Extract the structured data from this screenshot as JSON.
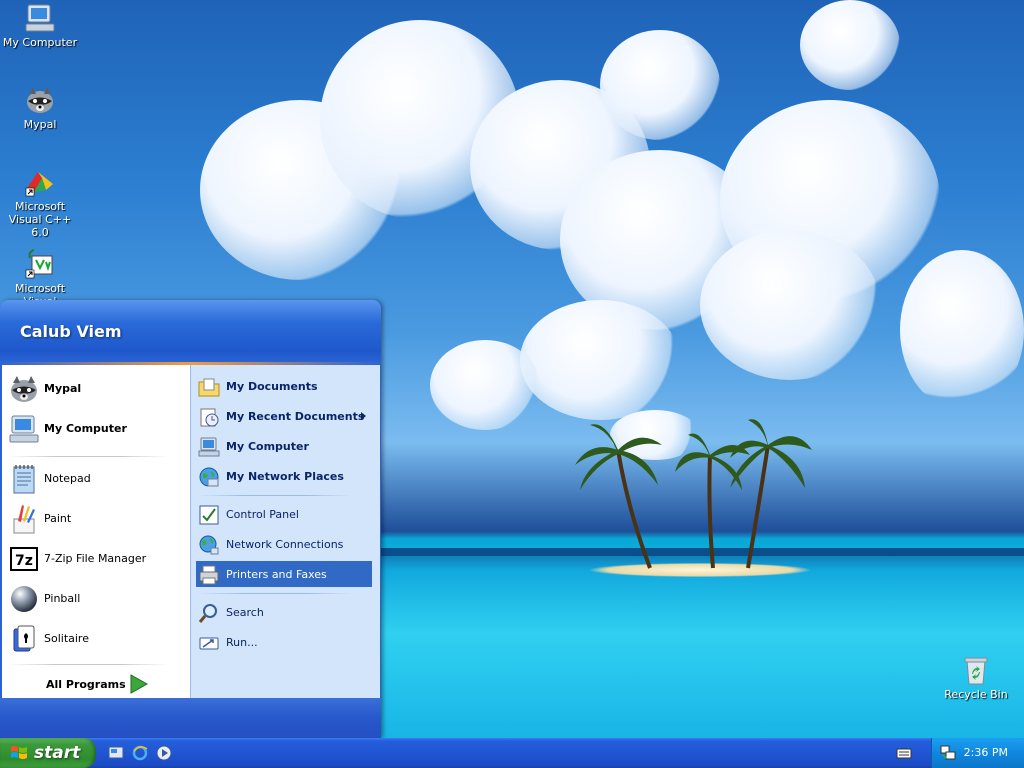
{
  "desktop": {
    "icons": [
      {
        "label": "My Computer",
        "icon": "computer-icon"
      },
      {
        "label": "Mypal",
        "icon": "raccoon-icon"
      },
      {
        "label": "Microsoft Visual C++ 6.0",
        "icon": "visual-cpp-icon"
      },
      {
        "label": "Microsoft Visual",
        "icon": "visual-studio-icon"
      },
      {
        "label": "Recycle Bin",
        "icon": "recycle-bin-icon"
      }
    ]
  },
  "start_menu": {
    "user_name": "Calub Viem",
    "pinned": [
      {
        "label": "Mypal",
        "icon": "raccoon-icon"
      },
      {
        "label": "My Computer",
        "icon": "computer-icon"
      }
    ],
    "recent": [
      {
        "label": "Notepad",
        "icon": "notepad-icon"
      },
      {
        "label": "Paint",
        "icon": "paint-icon"
      },
      {
        "label": "7-Zip File Manager",
        "icon": "7zip-icon"
      },
      {
        "label": "Pinball",
        "icon": "pinball-icon"
      },
      {
        "label": "Solitaire",
        "icon": "solitaire-icon"
      }
    ],
    "all_programs": "All Programs",
    "places": [
      {
        "label": "My Documents",
        "icon": "folder-documents-icon"
      },
      {
        "label": "My Recent Documents",
        "icon": "recent-documents-icon"
      },
      {
        "label": "My Computer",
        "icon": "computer-icon"
      },
      {
        "label": "My Network Places",
        "icon": "network-places-icon"
      }
    ],
    "system": [
      {
        "label": "Control Panel",
        "icon": "control-panel-icon"
      },
      {
        "label": "Network Connections",
        "icon": "network-connections-icon"
      },
      {
        "label": "Printers and Faxes",
        "icon": "printer-icon"
      }
    ],
    "tools": [
      {
        "label": "Search",
        "icon": "search-icon"
      },
      {
        "label": "Run...",
        "icon": "run-icon"
      }
    ]
  },
  "taskbar": {
    "start_label": "start",
    "quick_launch": [
      "show-desktop-icon",
      "internet-explorer-icon",
      "media-player-icon"
    ],
    "clock": "2:36 PM"
  },
  "colors": {
    "taskbar_blue": "#245edc",
    "start_green": "#3c9b3c",
    "tray_blue": "#0f88df",
    "menu_header": "#2a6ad9",
    "highlight": "#316ac5"
  }
}
